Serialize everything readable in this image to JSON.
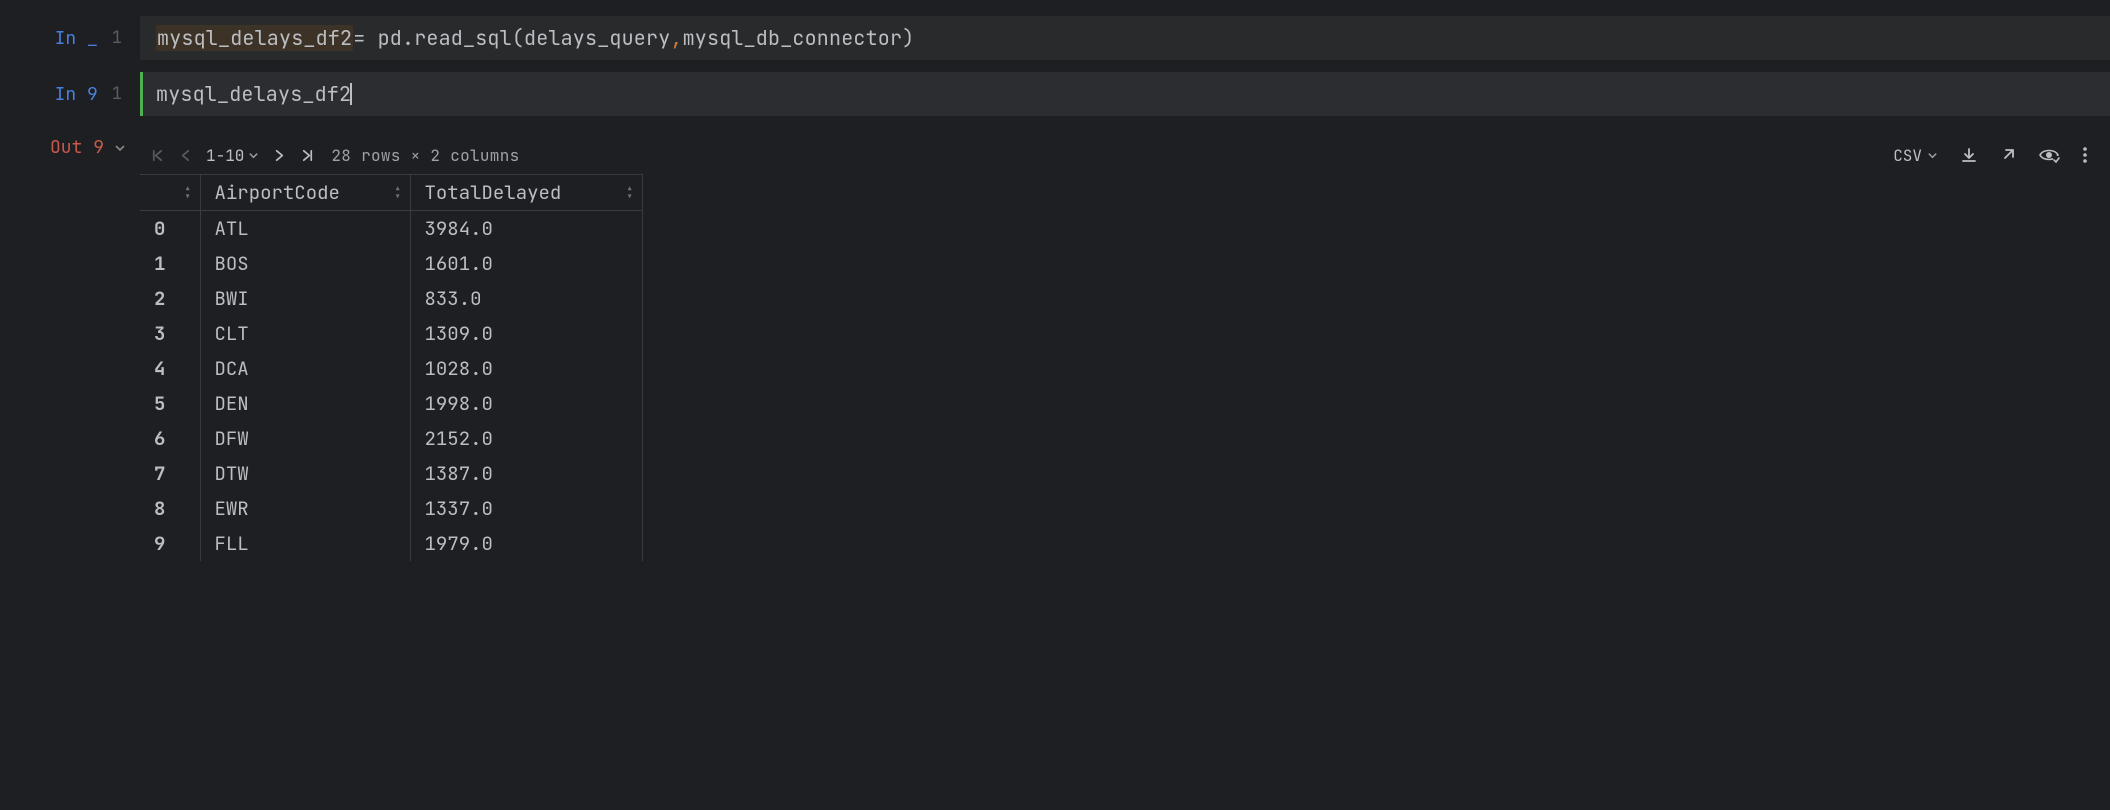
{
  "cell1": {
    "prompt": "In _",
    "lineno": "1",
    "code_var": "mysql_delays_df2",
    "code_rest_1": " = pd.read_sql(delays_query",
    "code_rest_2": " mysql_db_connector)"
  },
  "cell2": {
    "prompt": "In 9",
    "lineno": "1",
    "code": "mysql_delays_df2"
  },
  "out": {
    "prompt": "Out 9",
    "range": "1-10",
    "meta": "28 rows × 2 columns",
    "csv_label": "CSV"
  },
  "table": {
    "headers": [
      "",
      "AirportCode",
      "TotalDelayed"
    ],
    "rows": [
      {
        "idx": "0",
        "code": "ATL",
        "val": "3984.0"
      },
      {
        "idx": "1",
        "code": "BOS",
        "val": "1601.0"
      },
      {
        "idx": "2",
        "code": "BWI",
        "val": "833.0"
      },
      {
        "idx": "3",
        "code": "CLT",
        "val": "1309.0"
      },
      {
        "idx": "4",
        "code": "DCA",
        "val": "1028.0"
      },
      {
        "idx": "5",
        "code": "DEN",
        "val": "1998.0"
      },
      {
        "idx": "6",
        "code": "DFW",
        "val": "2152.0"
      },
      {
        "idx": "7",
        "code": "DTW",
        "val": "1387.0"
      },
      {
        "idx": "8",
        "code": "EWR",
        "val": "1337.0"
      },
      {
        "idx": "9",
        "code": "FLL",
        "val": "1979.0"
      }
    ]
  }
}
